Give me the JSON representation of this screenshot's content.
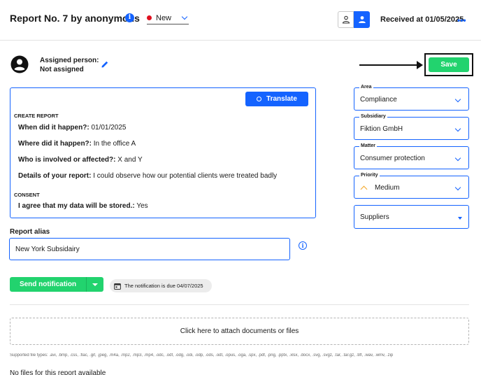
{
  "header": {
    "title": "Report No. 7 by anonymous",
    "status": "New",
    "received": "Received at 01/05/2025",
    "more": "•••",
    "info_glyph": "i"
  },
  "assigned": {
    "label": "Assigned person:",
    "value": "Not assigned"
  },
  "save_label": "Save",
  "report": {
    "translate_label": "Translate",
    "sections": [
      {
        "title": "CREATE REPORT",
        "items": [
          {
            "question": "When did it happen?:",
            "answer": "01/01/2025"
          },
          {
            "question": "Where did it happen?:",
            "answer": "In the office A"
          },
          {
            "question": "Who is involved or affected?:",
            "answer": "X and Y"
          },
          {
            "question": "Details of your report:",
            "answer": "I could observe how our potential clients were treated badly"
          }
        ]
      },
      {
        "title": "CONSENT",
        "items": [
          {
            "question": "I agree that my data will be stored.:",
            "answer": "Yes"
          }
        ]
      }
    ]
  },
  "alias": {
    "label": "Report alias",
    "value": "New York Subsidairy"
  },
  "notification": {
    "send_label": "Send notification",
    "due_text": "The notification is due 04/07/2025"
  },
  "attachments": {
    "drop_label": "Click here to attach documents or files",
    "file_types": "Supported file types: .avi, .bmp, .css, .flac, .gif, .jpeg, .m4a, .mp2, .mp3, .mp4, .odc, .odf, .odg, .odi, .odp, .ods, .odt, .opus, .oga, .spx, .pdf, .png, .pptx, .xlsx, .docx, .svg, .svgz, .tar, .tar.gz, .tiff, .wav, .wmv, .zip",
    "empty_text": "No files for this report available"
  },
  "fields": {
    "area": {
      "label": "Area",
      "value": "Compliance"
    },
    "subsidiary": {
      "label": "Subsidiary",
      "value": "Fiktion GmbH"
    },
    "matter": {
      "label": "Matter",
      "value": "Consumer protection"
    },
    "priority": {
      "label": "Priority",
      "value": "Medium"
    },
    "suppliers": {
      "value": "Suppliers"
    }
  },
  "colors": {
    "accent": "#1463ff",
    "success": "#22d36e",
    "status_new": "#e0101f",
    "priority_medium": "#f5a623"
  }
}
